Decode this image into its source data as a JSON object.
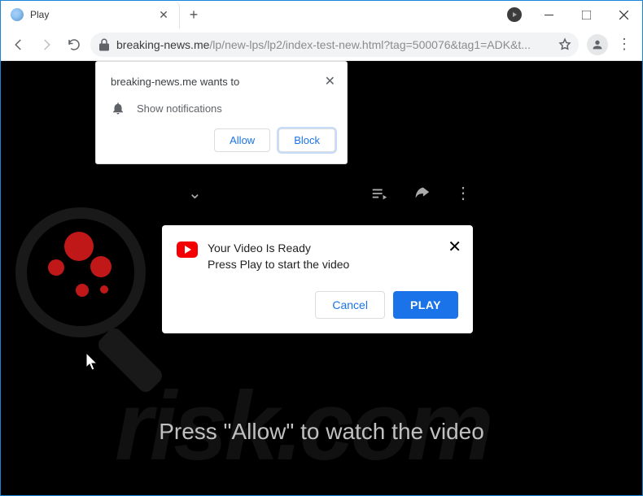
{
  "window": {
    "tab_title": "Play",
    "controls": {
      "min": "minimize",
      "max": "maximize",
      "close": "close"
    }
  },
  "addr": {
    "host": "breaking-news.me",
    "path": "/lp/new-lps/lp2/index-test-new.html?tag=500076&tag1=ADK&t..."
  },
  "perm_popup": {
    "origin_msg": "breaking-news.me wants to",
    "permission_label": "Show notifications",
    "allow": "Allow",
    "block": "Block"
  },
  "modal": {
    "title": "Your Video Is Ready",
    "subtitle": "Press Play to start the video",
    "cancel": "Cancel",
    "play": "PLAY"
  },
  "page": {
    "instruction": "Press \"Allow\" to watch the video",
    "watermark_text": "risk.com"
  },
  "colors": {
    "accent_blue": "#1a73e8",
    "youtube_red": "#f40002",
    "window_border": "#1a84d6"
  }
}
